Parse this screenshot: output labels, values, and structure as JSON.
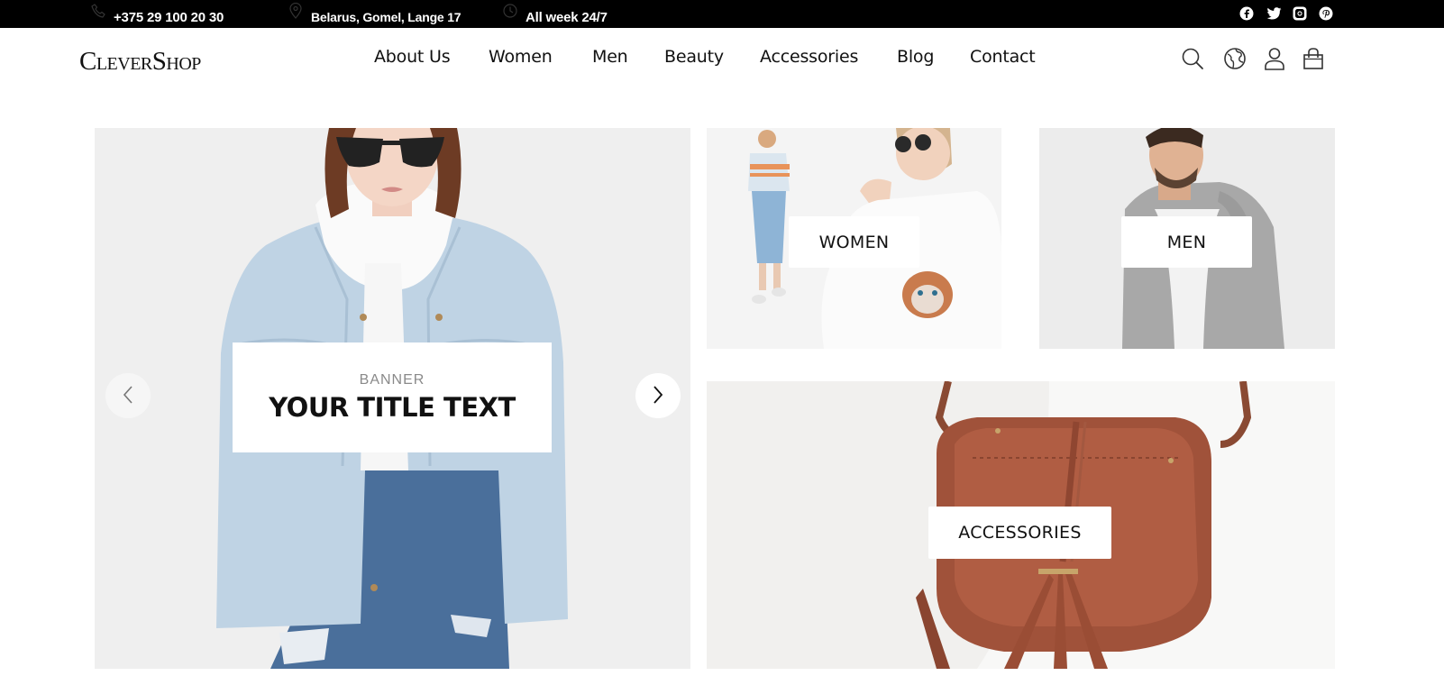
{
  "topbar": {
    "phone": "+375 29 100 20 30",
    "phone_icon": "phone-icon",
    "address": "Belarus, Gomel, Lange 17",
    "address_icon": "location-pin-icon",
    "hours": "All week 24/7",
    "hours_icon": "clock-icon",
    "social": [
      "facebook-icon",
      "twitter-icon",
      "instagram-icon",
      "pinterest-icon"
    ]
  },
  "header": {
    "logo": "CleverShop",
    "nav": [
      "About Us",
      "Women",
      "Men",
      "Beauty",
      "Accessories",
      "Blog",
      "Contact"
    ],
    "icons": [
      "search-icon",
      "globe-icon",
      "user-icon",
      "shopping-bag-icon"
    ]
  },
  "hero": {
    "subtitle": "BANNER",
    "title": "YOUR TITLE TEXT",
    "prev_icon": "chevron-left-icon",
    "next_icon": "chevron-right-icon"
  },
  "tiles": {
    "women": "WOMEN",
    "men": "MEN",
    "accessories": "ACCESSORIES"
  },
  "colors": {
    "topbar_bg": "#000000",
    "text": "#111111",
    "banner_subtitle": "#8a8a8a",
    "bag": "#a0523a"
  }
}
